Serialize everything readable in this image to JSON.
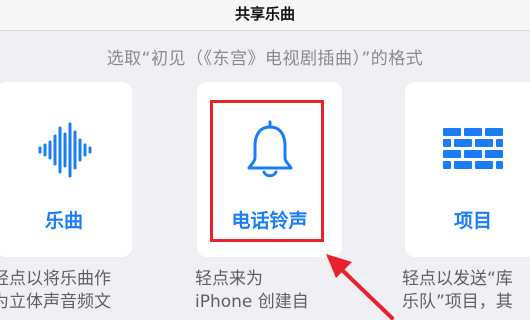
{
  "header": {
    "title": "共享乐曲"
  },
  "prompt": {
    "text": "选取“初见（《东宫》电视剧插曲）”的格式"
  },
  "options": [
    {
      "label": "乐曲",
      "icon": "waveform-icon",
      "desc_lines": [
        "轻点以将乐曲作",
        "为立体声音频文"
      ]
    },
    {
      "label": "电话铃声",
      "icon": "bell-icon",
      "desc_lines": [
        "轻点来为",
        "iPhone 创建自"
      ]
    },
    {
      "label": "项目",
      "icon": "brick-wall-icon",
      "desc_lines": [
        "轻点以发送“库",
        "乐队”项目，其"
      ]
    }
  ],
  "colors": {
    "accent": "#1a7df5",
    "highlight": "#e8222a",
    "background": "#efeff4"
  }
}
